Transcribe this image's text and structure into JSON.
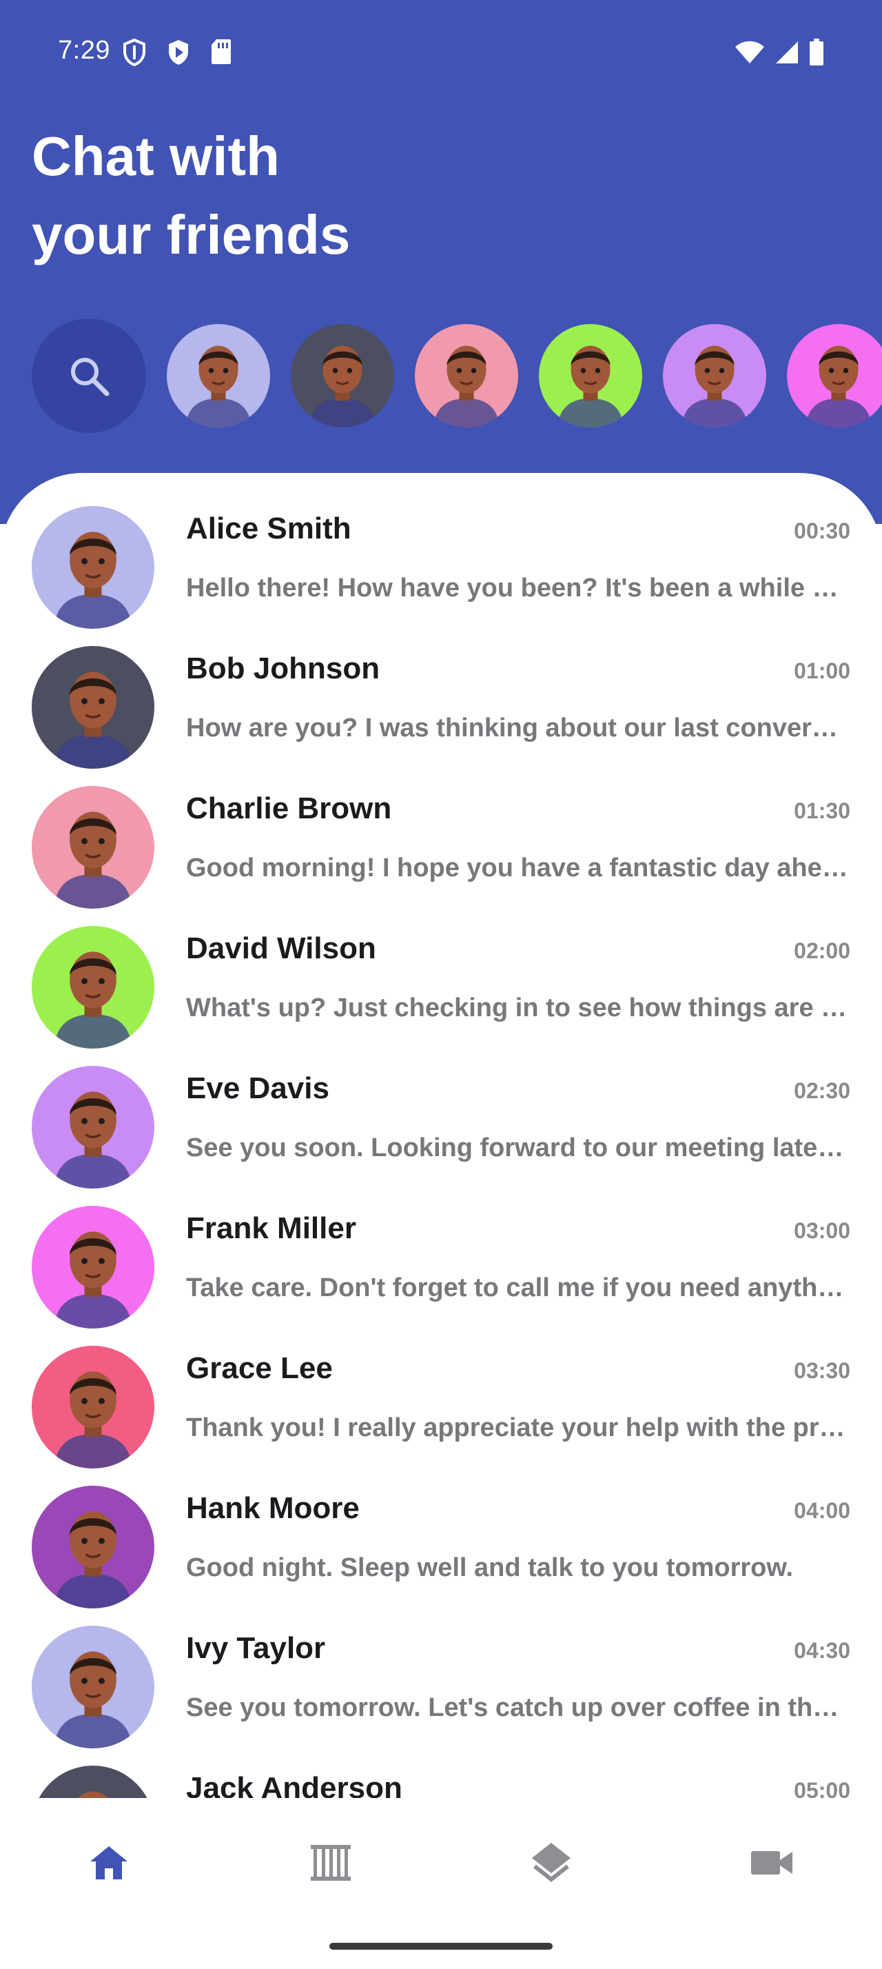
{
  "status_bar": {
    "time": "7:29",
    "left_icons": [
      "shield-outline-icon",
      "play-shield-icon",
      "sd-card-icon"
    ],
    "right_icons": [
      "wifi-icon",
      "signal-icon",
      "battery-icon"
    ]
  },
  "header": {
    "title_line1": "Chat with",
    "title_line2": "your friends",
    "background_color": "#4153b5"
  },
  "stories": [
    {
      "name": "Alice Smith",
      "bg": "#b6b7ec"
    },
    {
      "name": "Bob Johnson",
      "bg": "#4b4f5f"
    },
    {
      "name": "Charlie Brown",
      "bg": "#f199ad"
    },
    {
      "name": "David Wilson",
      "bg": "#9cf04e"
    },
    {
      "name": "Eve Davis",
      "bg": "#c98cf4"
    },
    {
      "name": "Frank Miller",
      "bg": "#f56ff3"
    }
  ],
  "chats": [
    {
      "name": "Alice Smith",
      "time": "00:30",
      "message": "Hello there! How have you been? It's been a while since we last talked.",
      "bg": "#b6b7ec"
    },
    {
      "name": "Bob Johnson",
      "time": "01:00",
      "message": "How are you? I was thinking about our last conversation and wanted to follow up.",
      "bg": "#4b4f5f"
    },
    {
      "name": "Charlie Brown",
      "time": "01:30",
      "message": "Good morning! I hope you have a fantastic day ahead of you.",
      "bg": "#f199ad"
    },
    {
      "name": "David Wilson",
      "time": "02:00",
      "message": "What's up? Just checking in to see how things are going with you.",
      "bg": "#9cf04e"
    },
    {
      "name": "Eve Davis",
      "time": "02:30",
      "message": "See you soon. Looking forward to our meeting later this week.",
      "bg": "#c98cf4"
    },
    {
      "name": "Frank Miller",
      "time": "03:00",
      "message": "Take care. Don't forget to call me if you need anything at all.",
      "bg": "#f56ff3"
    },
    {
      "name": "Grace Lee",
      "time": "03:30",
      "message": "Thank you! I really appreciate your help with the project yesterday.",
      "bg": "#f25d83"
    },
    {
      "name": "Hank Moore",
      "time": "04:00",
      "message": "Good night. Sleep well and talk to you tomorrow.",
      "bg": "#9a48b8"
    },
    {
      "name": "Ivy Taylor",
      "time": "04:30",
      "message": "See you tomorrow. Let's catch up over coffee in the morning.",
      "bg": "#b6b7ec"
    },
    {
      "name": "Jack Anderson",
      "time": "05:00",
      "message": "",
      "bg": "#4b4f5f"
    }
  ],
  "bottom_nav": [
    {
      "icon": "home-icon",
      "active": true
    },
    {
      "icon": "columns-icon",
      "active": false
    },
    {
      "icon": "layers-icon",
      "active": false
    },
    {
      "icon": "video-camera-icon",
      "active": false
    }
  ],
  "colors": {
    "accent": "#4153b5",
    "inactive_icon": "#8e8e93",
    "name_text": "#1b1b1f",
    "message_text": "#77777c"
  }
}
